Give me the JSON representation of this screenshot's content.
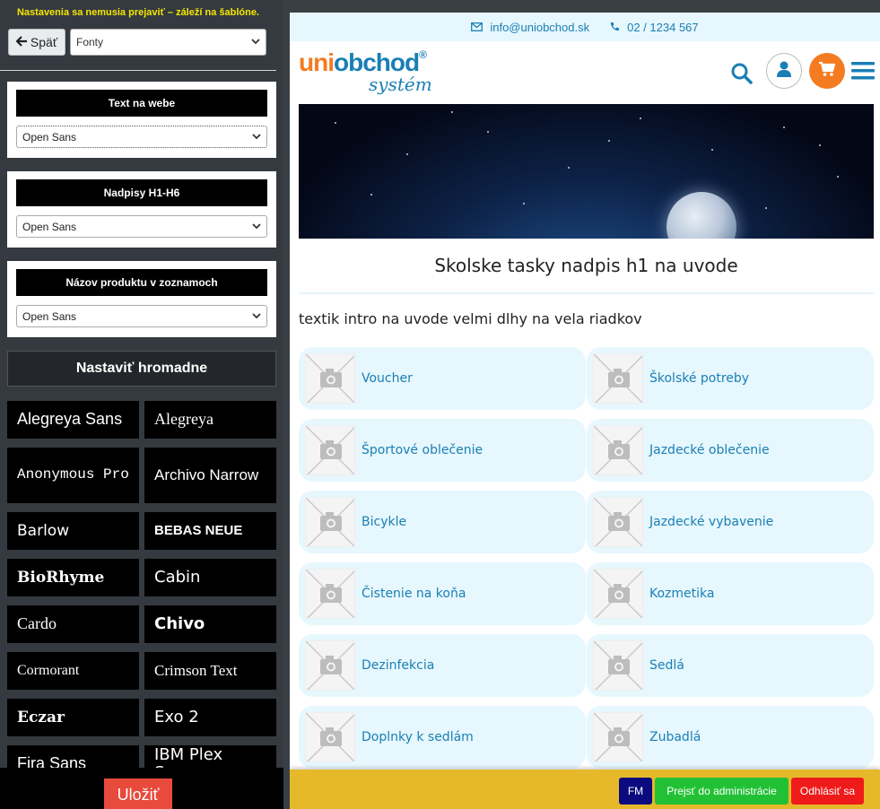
{
  "editor": {
    "notice": "Nastavenia sa nemusia prejaviť – záleží na šablóne.",
    "back_label": "Späť",
    "section_select": "Fonty",
    "boxes": [
      {
        "title": "Text na webe",
        "value": "Open Sans"
      },
      {
        "title": "Nadpisy H1-H6",
        "value": "Open Sans"
      },
      {
        "title": "Názov produktu v zoznamoch",
        "value": "Open Sans"
      }
    ],
    "bulk_label": "Nastaviť hromadne",
    "fonts": [
      "Alegreya Sans",
      "Alegreya",
      "Anonymous Pro",
      "Archivo Narrow",
      "Barlow",
      "BEBAS NEUE",
      "BioRhyme",
      "Cabin",
      "Cardo",
      "Chivo",
      "Cormorant",
      "Crimson Text",
      "Eczar",
      "Exo 2",
      "Fira Sans",
      "IBM Plex Sans"
    ],
    "save_label": "Uložiť"
  },
  "site": {
    "email": "info@uniobchod.sk",
    "phone": "02 / 1234 567",
    "logo_uni": "uni",
    "logo_obchod": "obchod",
    "logo_reg": "®",
    "logo_sub": "systém",
    "heading": "Skolske tasky nadpis h1 na uvode",
    "intro": "textik intro na uvode velmi dlhy na vela riadkov",
    "categories": [
      "Voucher",
      "Školské potreby",
      "Športové oblečenie",
      "Jazdecké oblečenie",
      "Bicykle",
      "Jazdecké vybavenie",
      "Čistenie na koňa",
      "Kozmetika",
      "Dezinfekcia",
      "Sedlá",
      "Doplnky k sedlám",
      "Zubadlá"
    ]
  },
  "admin_bar": {
    "fm": "FM",
    "admin": "Prejsť do administrácie",
    "logout": "Odhlásiť sa"
  },
  "colors": {
    "accent_blue": "#1a7fb5",
    "accent_orange": "#f47b20",
    "tile_bg": "#e6f7fd"
  }
}
